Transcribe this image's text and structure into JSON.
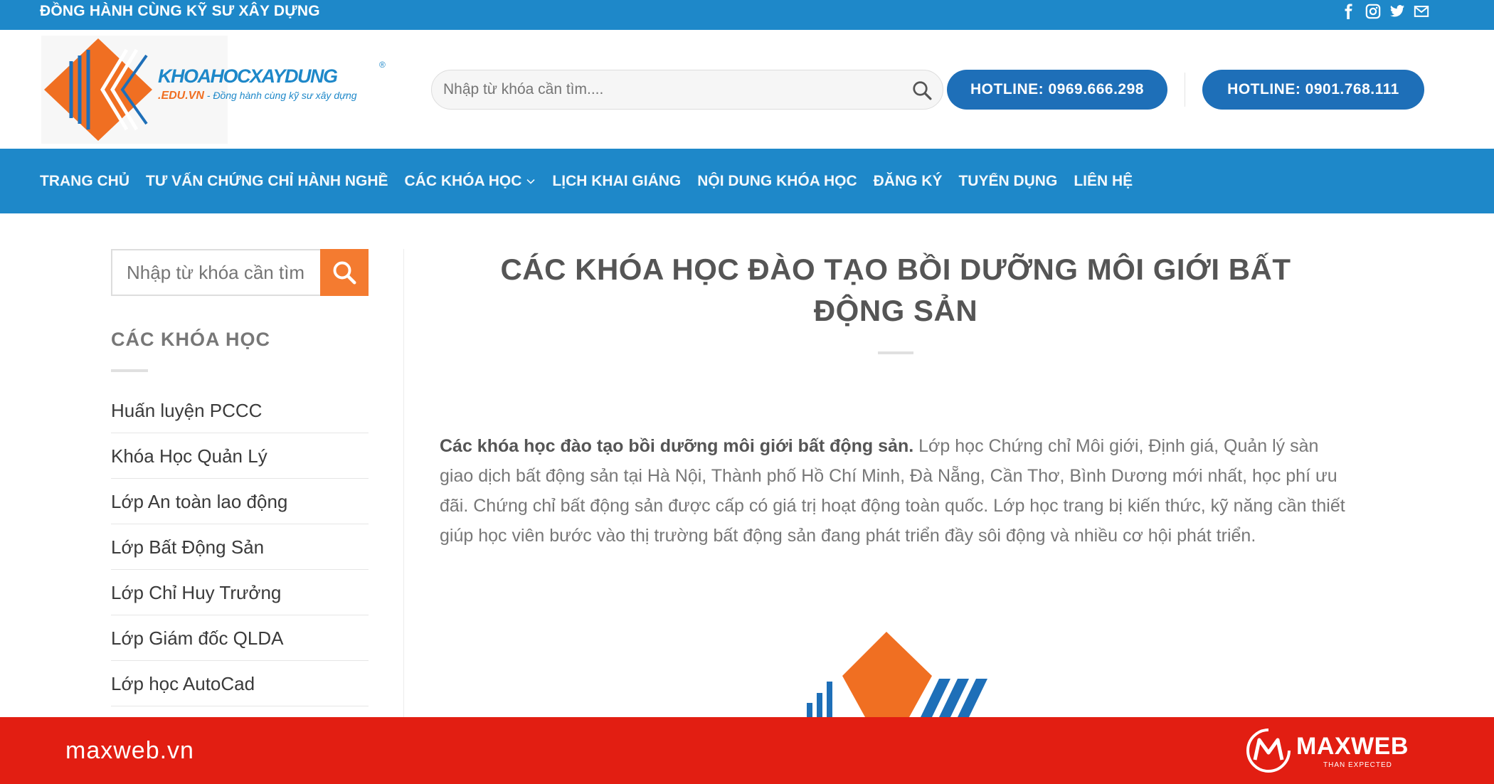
{
  "topbar": {
    "tagline": "ĐỒNG HÀNH CÙNG KỸ SƯ XÂY DỰNG",
    "social_icons": [
      "facebook-icon",
      "instagram-icon",
      "twitter-icon",
      "envelope-icon"
    ]
  },
  "header": {
    "logo_text": "KHOAHOCXAYDUNG",
    "logo_domain": ".EDU.VN",
    "logo_slogan": " - Đồng hành cùng kỹ sư xây dựng",
    "logo_reg": "®",
    "search_placeholder": "Nhập từ khóa cần tìm....",
    "hotline_1": "HOTLINE: 0969.666.298",
    "hotline_2": "HOTLINE: 0901.768.111"
  },
  "nav": {
    "items": [
      {
        "label": "TRANG CHỦ"
      },
      {
        "label": "TƯ VẤN CHỨNG CHỈ HÀNH NGHỀ"
      },
      {
        "label": "CÁC KHÓA HỌC"
      },
      {
        "label": "LỊCH KHAI GIẢNG"
      },
      {
        "label": "NỘI DUNG KHÓA HỌC"
      },
      {
        "label": "ĐĂNG KÝ"
      },
      {
        "label": "TUYỂN DỤNG"
      },
      {
        "label": "LIÊN HỆ"
      }
    ]
  },
  "sidebar": {
    "search_placeholder": "Nhập từ khóa cần tìm",
    "title": "CÁC KHÓA HỌC",
    "items": [
      {
        "label": "Huấn luyện PCCC"
      },
      {
        "label": "Khóa Học Quản Lý"
      },
      {
        "label": "Lớp An toàn lao động"
      },
      {
        "label": "Lớp Bất Động Sản"
      },
      {
        "label": "Lớp Chỉ Huy Trưởng"
      },
      {
        "label": "Lớp Giám đốc QLDA"
      },
      {
        "label": "Lớp học AutoCad"
      }
    ]
  },
  "main": {
    "title_line1": "CÁC KHÓA HỌC ĐÀO TẠO BỒI DƯỠNG MÔI GIỚI BẤT",
    "title_line2": "ĐỘNG SẢN",
    "intro_bold": "Các khóa học đào tạo bồi dưỡng môi giới bất động sản.",
    "intro_text": " Lớp học Chứng chỉ Môi giới, Định giá, Quản lý sàn giao dịch bất động sản tại Hà Nội, Thành phố Hồ Chí Minh, Đà Nẵng, Cần Thơ, Bình Dương mới nhất, học phí ưu đãi. Chứng chỉ bất động sản được cấp có giá trị hoạt động toàn quốc. Lớp học trang bị kiến thức, kỹ năng cần thiết giúp học viên bước vào thị trường bất động sản đang phát triển đầy sôi động và nhiều cơ hội phát triển."
  },
  "footerbar": {
    "site": "maxweb.vn",
    "brand_name": "MAXWEB",
    "brand_tag": "THAN EXPECTED"
  },
  "colors": {
    "primary_blue": "#1e88c9",
    "hotline_blue": "#1e6fb8",
    "orange": "#f47b30",
    "footer_red": "#e21e12"
  }
}
